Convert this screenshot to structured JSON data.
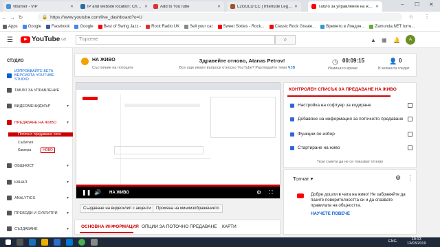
{
  "browser": {
    "tabs": [
      {
        "title": "vBunter - VIP",
        "color": "#4a90d9"
      },
      {
        "title": "IP and website location: Check h",
        "color": "#2c6e9e"
      },
      {
        "title": "Add to YouTube",
        "color": "#d33"
      },
      {
        "title": "L2GOLD.CC | Interlude Legendar",
        "color": "#a0522d"
      },
      {
        "title": "Табло за управление на живо",
        "color": "#f00"
      }
    ],
    "url": "https://www.youtube.com/live_dashboard?o=U",
    "bookmarks": [
      {
        "label": "Apps",
        "color": "#5f6368"
      },
      {
        "label": "Google",
        "color": "#4285f4"
      },
      {
        "label": "Facebook",
        "color": "#3b5998"
      },
      {
        "label": "Google",
        "color": "#4285f4"
      },
      {
        "label": "Best of Swing Jazz -",
        "color": "#f00"
      },
      {
        "label": "Rock Radio UK",
        "color": "#d33"
      },
      {
        "label": "Sell your car",
        "color": "#888"
      },
      {
        "label": "Sweet Sixties - Rock...",
        "color": "#f00"
      },
      {
        "label": "Classic Rock Greate...",
        "color": "#f00"
      },
      {
        "label": "Времето в Лондон...",
        "color": "#39c"
      },
      {
        "label": "Zamunda.NET torre...",
        "color": "#6a3"
      }
    ]
  },
  "youtube": {
    "logo": "YouTube",
    "logo_region": "GB",
    "search_placeholder": "Търсене",
    "avatar_count": "1"
  },
  "sidebar": {
    "header": "СТУДИО",
    "items": [
      {
        "label": "ИЗПРОБВАЙТЕ БЕТА ВЕРСИЯТА YOUTUBE STUDIO",
        "accent": true
      },
      {
        "label": "ТАБЛО ЗА УПРАВЛЕНИЕ"
      },
      {
        "label": "ВИДЕОМЕНИДЖЪР"
      },
      {
        "label": "ПРЕДАВАНЕ НА ЖИВО",
        "active": true
      },
      {
        "label": "ОБЩНОСТ"
      },
      {
        "label": "КАНАЛ"
      },
      {
        "label": "ANALYTICS"
      },
      {
        "label": "ПРЕВОДИ И СУБТИТРИ"
      },
      {
        "label": "СЪЗДАВАНЕ"
      }
    ],
    "subitems": [
      {
        "label": "Поточно предаване сега",
        "active": true
      },
      {
        "label": "Събития"
      },
      {
        "label": "Камера",
        "badge": "НОВО"
      }
    ]
  },
  "status": {
    "live_label": "НА ЖИВО",
    "stream_status": "Състояние на потоците",
    "welcome": "Здравейте отново, Atanas Petrov!",
    "question": "Все още имате въпроси относно YouTube? Разгледайте теми",
    "question_link": "ЧЗВ",
    "elapsed": "00:09:15",
    "elapsed_label": "Изминало време",
    "viewers": "0",
    "viewers_label": "В момента гледат"
  },
  "checklist": {
    "title": "КОНТРОЛЕН СПИСЪК ЗА ПРЕДАВАНЕ НА ЖИВО",
    "items": [
      "Настройка на софтуер за кодиране",
      "Добавяне на информация за поточното предаване",
      "Функции по избор",
      "Стартиране на живо"
    ],
    "footer": "Тези съвети да не се показват отново"
  },
  "chat": {
    "header": "Топчат",
    "message": "Добре дошли в чата на живо! Не забравяйте да пазите поверителността си и да спазвате правилата на общността.",
    "link": "НАУЧЕТЕ ПОВЕЧЕ"
  },
  "video": {
    "badge": "НА ЖИВО",
    "buttons": [
      "Създаване на видеоклип с акценти",
      "Промяна на миниизображението"
    ]
  },
  "tabs": [
    {
      "label": "ОСНОВНА ИНФОРМАЦИЯ",
      "active": true
    },
    {
      "label": "ОПЦИИ ЗА ПОТОЧНО ПРЕДАВАНЕ"
    },
    {
      "label": "КАРТИ"
    }
  ],
  "taskbar": {
    "lang": "ENG",
    "time": "19:13",
    "date": "13/03/2019"
  },
  "colors": {
    "accent": "#cc0000",
    "live": "#f4a000",
    "link": "#065fd4"
  }
}
